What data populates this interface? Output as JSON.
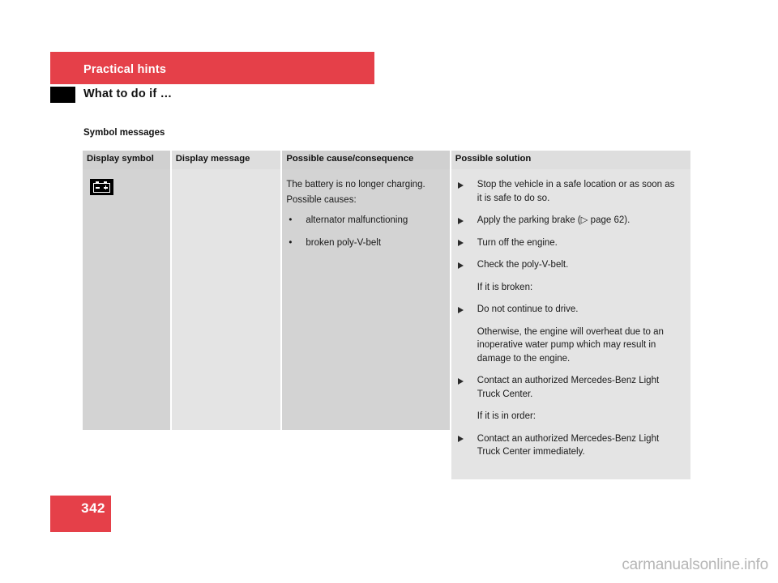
{
  "chapter": {
    "title": "Practical hints",
    "band_color": "#E54049"
  },
  "section": {
    "title": "What to do if …",
    "marker_color": "#000000"
  },
  "subsection": {
    "title": "Symbol messages"
  },
  "table": {
    "headers": [
      "Display symbol",
      "Display message",
      "Possible cause/consequence",
      "Possible solution"
    ],
    "column_shades": [
      "#D3D3D3",
      "#E4E4E4",
      "#D3D3D3",
      "#E4E4E4"
    ],
    "header_shades": [
      "#D0D0D0",
      "#DEDEDE",
      "#D0D0D0",
      "#DEDEDE"
    ],
    "rows": [
      {
        "display_symbol": {
          "icon": "battery-icon",
          "label": "battery warning symbol"
        },
        "display_message": "",
        "possible_cause": {
          "lines": [
            "The battery is no longer charging.",
            "Possible causes:"
          ],
          "bullets": [
            "alternator malfunctioning",
            "broken poly-V-belt"
          ],
          "bullet_glyph": "•"
        },
        "possible_solution": {
          "items": [
            {
              "arrow": true,
              "text": "Stop the vehicle in a safe location or as soon as it is safe to do so."
            },
            {
              "arrow": true,
              "text": "Apply the parking brake (▷ page 62)."
            },
            {
              "arrow": true,
              "text": "Turn off the engine."
            },
            {
              "arrow": true,
              "text": "Check the poly-V-belt."
            },
            {
              "arrow": false,
              "lead": true,
              "text": "If it is broken:"
            },
            {
              "arrow": true,
              "text": "Do not continue to drive."
            },
            {
              "arrow": false,
              "text": "Otherwise, the engine will overheat due to an inoperative water pump which may result in damage to the engine."
            },
            {
              "arrow": true,
              "text": "Contact an authorized Mercedes-Benz Light Truck Center."
            },
            {
              "arrow": false,
              "lead": true,
              "text": "If it is in order:"
            },
            {
              "arrow": true,
              "text": "Contact an authorized Mercedes-Benz Light Truck Center immediately."
            }
          ]
        }
      }
    ]
  },
  "footer": {
    "page_number": "342",
    "page_box_color": "#E54049",
    "watermark": "carmanualsonline.info"
  }
}
